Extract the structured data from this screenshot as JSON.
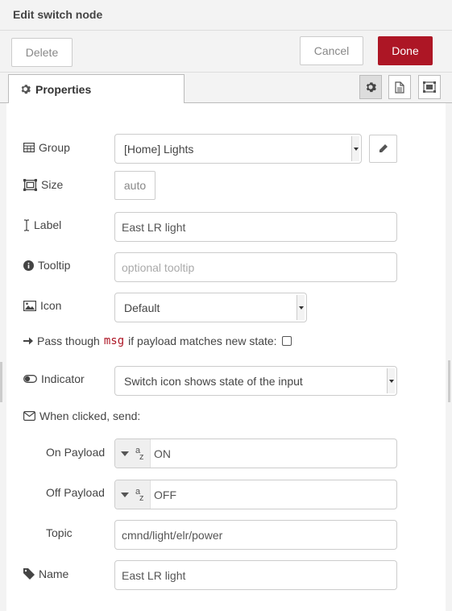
{
  "tray": {
    "title": "Edit switch node"
  },
  "toolbar": {
    "delete_label": "Delete",
    "cancel_label": "Cancel",
    "done_label": "Done"
  },
  "tabs": {
    "properties_label": "Properties"
  },
  "form": {
    "group_label": "Group",
    "group_value": "[Home] Lights",
    "size_label": "Size",
    "size_value": "auto",
    "label_label": "Label",
    "label_value": "East LR light",
    "tooltip_label": "Tooltip",
    "tooltip_placeholder": "optional tooltip",
    "icon_label": "Icon",
    "icon_value": "Default",
    "pass_prefix": "Pass though",
    "pass_code": "msg",
    "pass_suffix": "if payload matches new state:",
    "pass_checked": false,
    "indicator_label": "Indicator",
    "indicator_value": "Switch icon shows state of the input",
    "when_clicked_label": "When clicked, send:",
    "on_payload_label": "On Payload",
    "on_payload_type": "a z",
    "on_payload_value": "ON",
    "off_payload_label": "Off Payload",
    "off_payload_type": "a z",
    "off_payload_value": "OFF",
    "topic_label": "Topic",
    "topic_value": "cmnd/light/elr/power",
    "name_label": "Name",
    "name_value": "East LR light"
  },
  "colors": {
    "accent": "#ad1625",
    "background": "#f3f3f3",
    "panel": "#ffffff",
    "border": "#cccccc"
  }
}
